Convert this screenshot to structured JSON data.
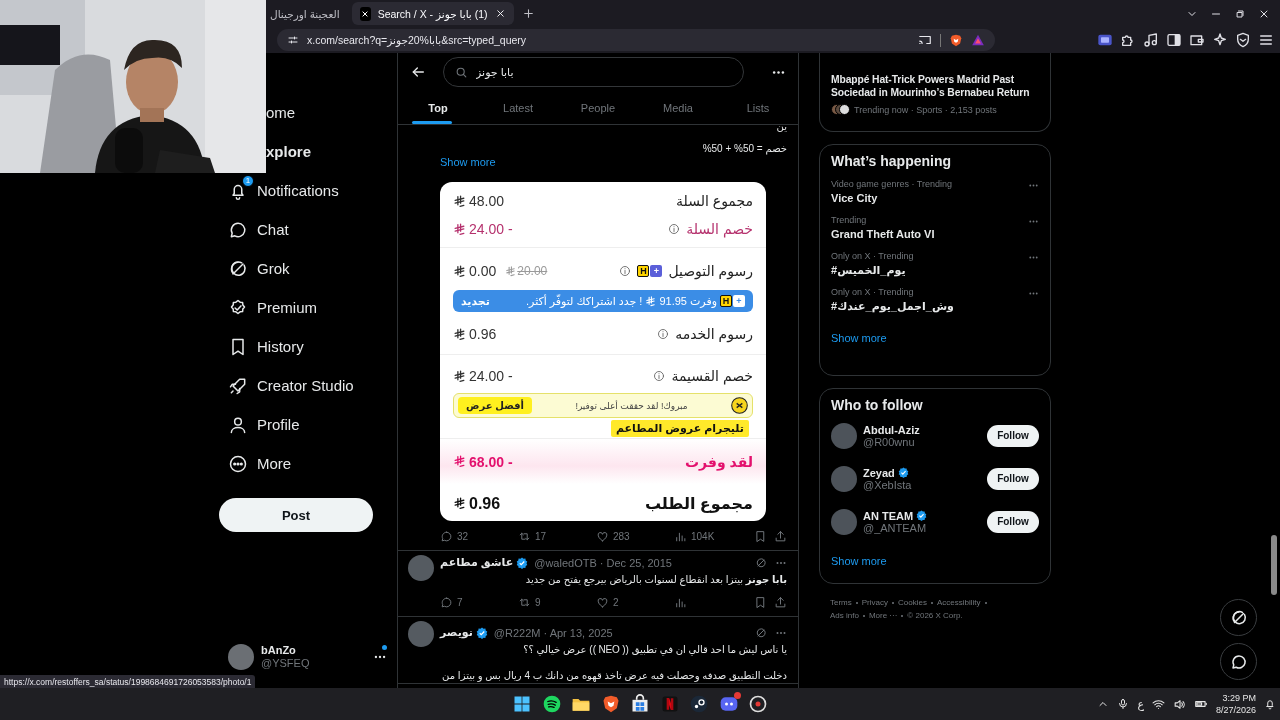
{
  "browser": {
    "left_tab": {
      "title": "العجينة اورجينال",
      "selected": false
    },
    "right_tab": {
      "title": "(1) بابا جونز - Search / X",
      "selected": true
    },
    "url": "x.com/search?q=بابا%20جونز&src=typed_query"
  },
  "nav": {
    "items": [
      {
        "label": "ome",
        "kind": "cut",
        "selected": false
      },
      {
        "label": "xplore",
        "kind": "cut",
        "selected": true
      },
      {
        "label": "Notifications",
        "kind": "full",
        "badge": "1",
        "selected": false
      },
      {
        "label": "Chat",
        "kind": "full",
        "selected": false
      },
      {
        "label": "Grok",
        "kind": "full",
        "selected": false
      },
      {
        "label": "Premium",
        "kind": "full",
        "selected": false
      },
      {
        "label": "History",
        "kind": "full",
        "selected": false
      },
      {
        "label": "Creator Studio",
        "kind": "full",
        "selected": false
      },
      {
        "label": "Profile",
        "kind": "full",
        "selected": false
      },
      {
        "label": "More",
        "kind": "full",
        "selected": false
      }
    ],
    "post": "Post",
    "account": {
      "name": "bAnZo",
      "handle": "@YSFEQ",
      "unread": true
    }
  },
  "search": {
    "value": "بابا جونز",
    "tabs": [
      {
        "label": "Top",
        "selected": true
      },
      {
        "label": "Latest",
        "selected": false
      },
      {
        "label": "People",
        "selected": false
      },
      {
        "label": "Media",
        "selected": false
      },
      {
        "label": "Lists",
        "selected": false
      }
    ]
  },
  "feed": [
    {
      "kind": "continued",
      "text": [
        "ين",
        "خصم = 50% + 50%"
      ],
      "show_more": "Show more",
      "receipt": {
        "sections": [
          [
            {
              "kind": "plain",
              "label": "مجموع السلة",
              "amount": "48.00"
            },
            {
              "kind": "discount",
              "label": "خصم السلة",
              "info": true,
              "amount": "24.00 -"
            }
          ],
          [
            {
              "kind": "plain",
              "label": "رسوم التوصيل",
              "info": true,
              "badge": [
                "H",
                "+"
              ],
              "amount": "0.00",
              "old_amount": "20.00"
            },
            {
              "kind": "promo",
              "badge": [
                "H",
                "+"
              ],
              "text_start": "وفرت 91.95",
              "text_end": "! جدد اشتراكك لتوفّر أكثر.",
              "action": "تجديد"
            },
            {
              "kind": "plain",
              "label": "رسوم الخدمه",
              "info": true,
              "amount": "0.96"
            }
          ],
          [
            {
              "kind": "plain",
              "label": "خصم القسيمة",
              "info": true,
              "amount": "24.00 -"
            },
            {
              "kind": "congrats",
              "text": "مبروك! لقد حققت أعلى توفير!",
              "action": "أفضل عرض"
            },
            {
              "kind": "sticker",
              "text": "تليجرام عروض المطاعم"
            }
          ],
          [
            {
              "kind": "saved",
              "label": "لقد وفرت",
              "amount": "68.00 -"
            }
          ],
          [
            {
              "kind": "total",
              "label": "مجموع الطلب",
              "amount": "0.96"
            }
          ]
        ]
      },
      "stats": {
        "replies": "32",
        "reposts": "17",
        "likes": "283",
        "views": "104K"
      }
    },
    {
      "kind": "post",
      "name": "عاشق مطاعم",
      "verified": true,
      "meta": "@waledOTB · Dec 25, 2015",
      "text": [
        "**بابا جونز** بيتزا بعد انقطاع لسنوات بالرياض بيرجع يفتح من جديد"
      ],
      "stats": {
        "replies": "7",
        "reposts": "9",
        "likes": "2"
      }
    },
    {
      "kind": "post",
      "name": "نويصر",
      "verified": true,
      "meta": "@R222M · Apr 13, 2025",
      "text": [
        "يا ناس ليش ما احد قالي ان في تطبيق (( NEO )) عرض خيالي ؟؟",
        "دخلت التطبيق صدفه وحصلت فيه عرض تاخذ قهوه من دانك ب 4 ريال بس و بيتزا من"
      ]
    }
  ],
  "trending_card": {
    "headline": "Mbappé Hat-Trick Powers Madrid Past Sociedad in Mourinho’s Bernabeu Return",
    "meta": "Trending now · Sports · 2,153 posts"
  },
  "whats_happening": {
    "title": "What’s happening",
    "trends": [
      {
        "meta": "Video game genres · Trending",
        "name": "Vice City"
      },
      {
        "meta": "Trending",
        "name": "Grand Theft Auto VI"
      },
      {
        "meta": "Only on X · Trending",
        "name": "#يوم_الخميس"
      },
      {
        "meta": "Only on X · Trending",
        "name": "#وش_اجمل_يوم_عندك"
      }
    ],
    "show_more": "Show more"
  },
  "who_to_follow": {
    "title": "Who to follow",
    "users": [
      {
        "name": "Abdul-Aziz",
        "handle": "@R00wnu",
        "verified": false,
        "action": "Follow"
      },
      {
        "name": "Zeyad",
        "handle": "@XebIsta",
        "verified": true,
        "action": "Follow"
      },
      {
        "name": "AN TEAM",
        "handle": "@_ANTEAM",
        "verified": true,
        "action": "Follow"
      }
    ],
    "show_more": "Show more"
  },
  "footer": {
    "links": [
      "Terms",
      "Privacy",
      "Cookies",
      "Accessibility",
      "Ads info",
      "More ···"
    ],
    "copyright": "© 2026 X Corp."
  },
  "status_link": "https://x.com/restoffers_sa/status/1998684691726053583/photo/1",
  "tray": {
    "language": "ع",
    "time": "3:29 PM",
    "date": "8/27/2026"
  }
}
